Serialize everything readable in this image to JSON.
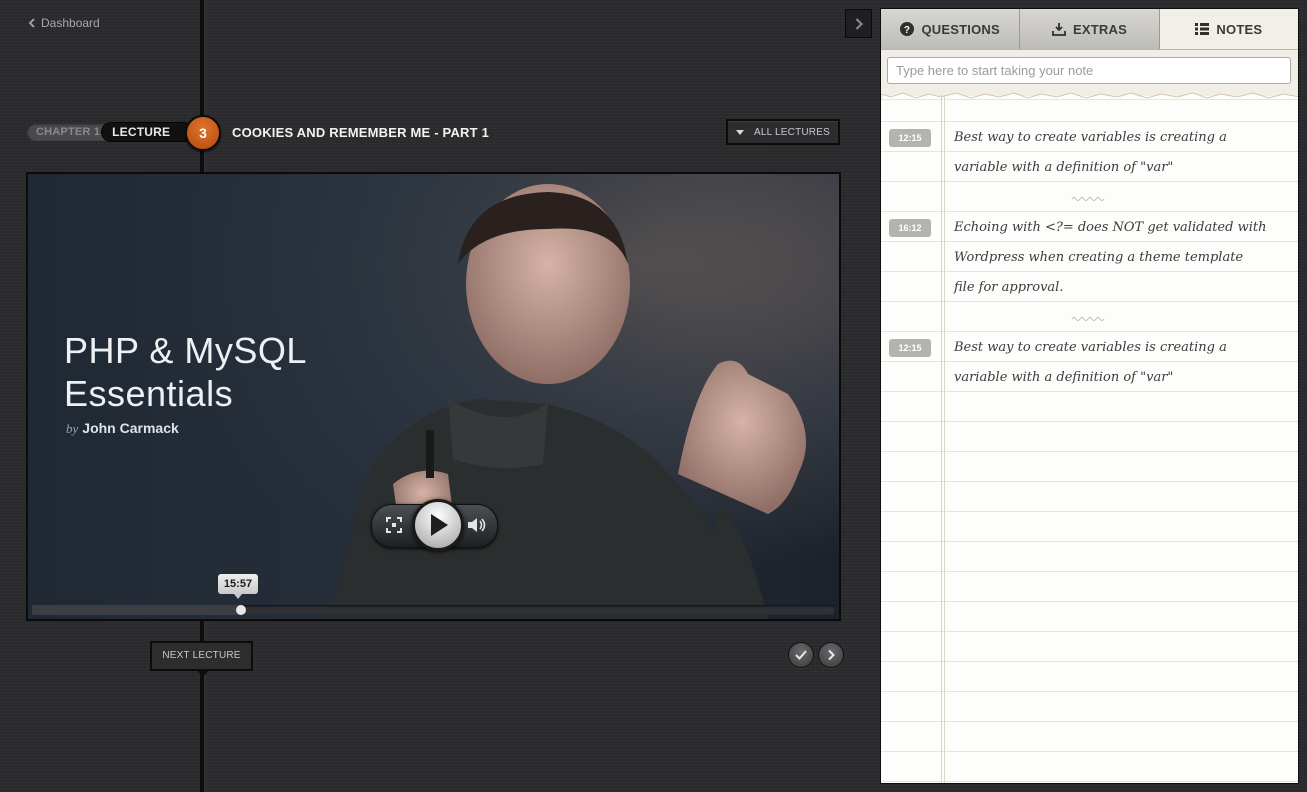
{
  "nav": {
    "back_label": "Dashboard"
  },
  "lecture_header": {
    "chapter": "CHAPTER 1",
    "lecture_label": "LECTURE",
    "lecture_number": "3",
    "title": "COOKIES AND REMEMBER ME - PART 1",
    "all_lectures": "ALL LECTURES"
  },
  "video": {
    "title_line1": "PHP & MySQL",
    "title_line2": "Essentials",
    "by": "by",
    "author": "John Carmack",
    "current_time": "15:57",
    "progress_fraction": 0.26
  },
  "footer": {
    "next_lecture": "NEXT LECTURE"
  },
  "panel": {
    "tabs": [
      {
        "label": "QUESTIONS",
        "icon": "question-icon"
      },
      {
        "label": "EXTRAS",
        "icon": "download-icon"
      },
      {
        "label": "NOTES",
        "icon": "list-icon",
        "active": true
      }
    ],
    "note_placeholder": "Type here to start taking your note",
    "notes": [
      {
        "time": "12:15",
        "lines": [
          "Best way to create variables is creating a",
          "variable with a definition of \"var\""
        ]
      },
      {
        "time": "16:12",
        "lines": [
          "Echoing with <?= does NOT get validated with",
          "Wordpress when creating a theme template",
          "file for approval."
        ]
      },
      {
        "time": "12:15",
        "lines": [
          "Best way to create variables is creating a",
          "variable with a definition of \"var\""
        ]
      }
    ]
  },
  "colors": {
    "accent": "#d7621d",
    "panel_bg": "#fdfdfb",
    "page_bg": "#2b2a2d"
  }
}
